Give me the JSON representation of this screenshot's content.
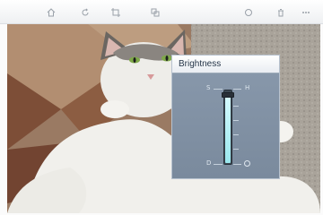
{
  "toolbar": {
    "icons": [
      "home-icon",
      "rotate-icon",
      "crop-icon",
      "adjust-icon",
      "favorite-icon",
      "delete-icon",
      "more-icon"
    ]
  },
  "photo": {
    "subject": "white cat lying on back"
  },
  "brightness_panel": {
    "title": "Brightness",
    "level": 0.93,
    "scale_top_left": "S",
    "scale_top_right": "H",
    "scale_bottom_left": "D"
  },
  "colors": {
    "panel_bg": "#7f8fa1",
    "slider_fill": "#9ae7ee",
    "toolbar_icon": "#9aa1a9"
  }
}
